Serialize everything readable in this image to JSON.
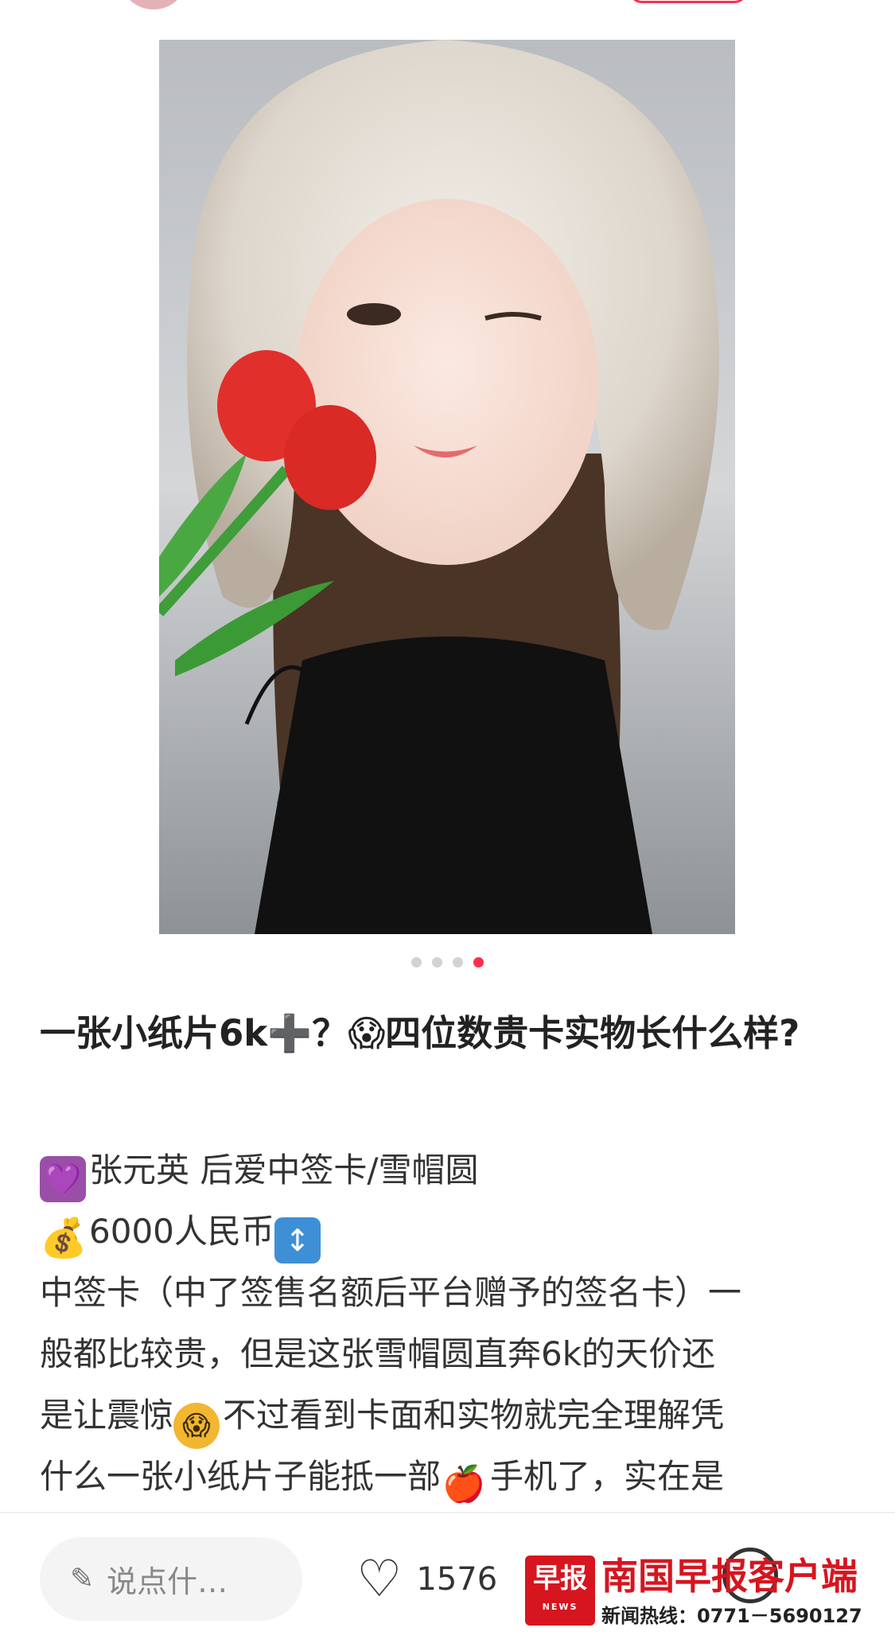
{
  "post": {
    "title": "一张小纸片6k➕？😱四位数贵卡实物长什么样?",
    "body_lines": [
      "张元英 后爱中签卡/雪帽圆",
      "6000人民币",
      "中签卡（中了签售名额后平台赠予的签名卡）一",
      "般都比较贵，但是这张雪帽圆直奔6k的天价还",
      "是让震惊",
      "不过看到卡面和实物就完全理解凭",
      "什么一张小纸片子能抵一部",
      "手机了，实在是"
    ],
    "emojis": {
      "heart": "💜",
      "money_bag": "💰",
      "up_down": "↕",
      "scream": "😱",
      "apple": "🍎"
    }
  },
  "carousel": {
    "total": 4,
    "active_index": 4
  },
  "bottom_bar": {
    "comment_placeholder": "说点什…",
    "like_count": "1576"
  },
  "watermark": {
    "logo_text": "早报",
    "logo_sub": "NEWS",
    "name": "南国早报客户端",
    "hotline": "新闻热线：0771－5690127"
  },
  "colors": {
    "accent": "#ff2e4d",
    "watermark_red": "#d6151f"
  }
}
